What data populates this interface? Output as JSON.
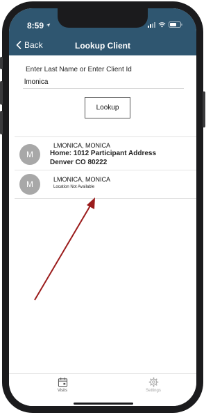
{
  "status_bar": {
    "time": "8:59"
  },
  "nav": {
    "back_label": "Back",
    "title": "Lookup Client"
  },
  "search": {
    "label": "Enter Last Name or Enter Client Id",
    "value": "lmonica",
    "button_label": "Lookup"
  },
  "results": [
    {
      "initial": "M",
      "name": "LMONICA, MONICA",
      "address_line1": "Home: 1012 Participant Address",
      "address_line2": "Denver CO 80222"
    },
    {
      "initial": "M",
      "name": "LMONICA, MONICA",
      "location": "Location Not Available"
    }
  ],
  "tab_bar": {
    "visits_label": "Visits",
    "settings_label": "Settings"
  },
  "colors": {
    "header": "#2f5670",
    "avatar": "#a8a8a8",
    "arrow": "#9b1c1c"
  },
  "icons": {
    "back": "chevron-left-icon",
    "visits": "calendar-icon",
    "settings": "gear-icon"
  }
}
